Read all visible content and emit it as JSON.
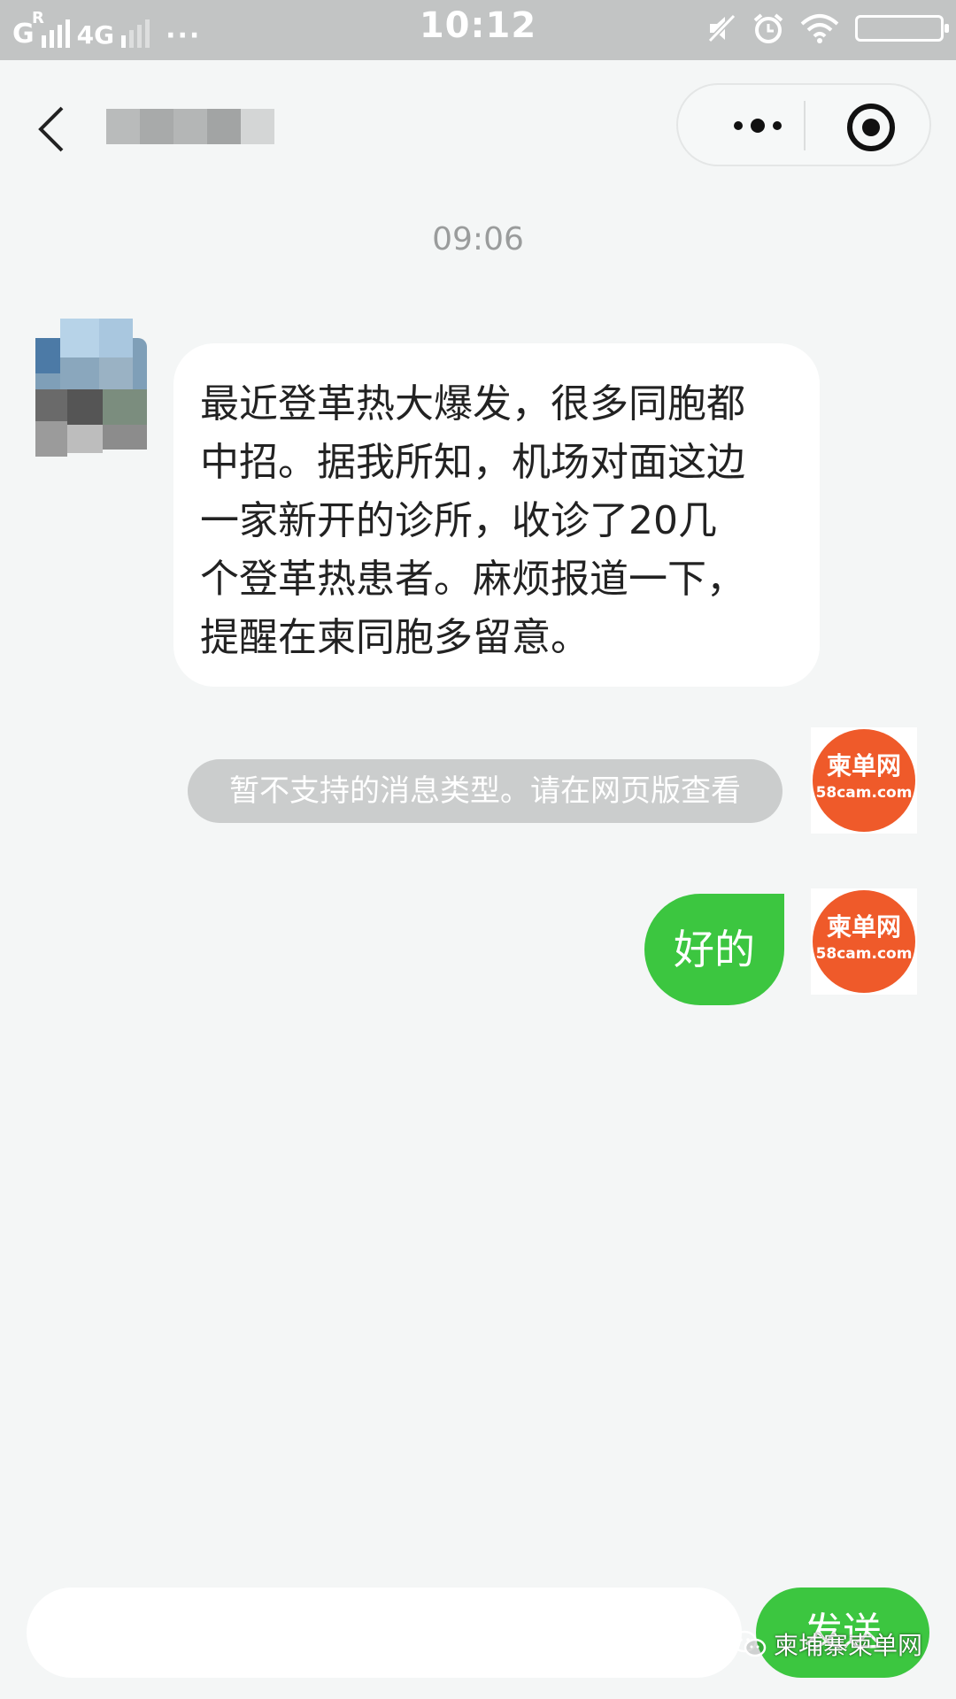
{
  "status_bar": {
    "network_primary": "G",
    "roaming": "R",
    "network_secondary": "4G",
    "more_dots": "···",
    "time": "10:12",
    "icons": [
      "signal-bars-icon",
      "mute-icon",
      "alarm-icon",
      "wifi-icon",
      "battery-icon"
    ]
  },
  "nav": {
    "back_icon": "chevron-left-icon",
    "title_blurred": true,
    "more_icon": "more-dots-icon",
    "close_icon": "target-circle-icon"
  },
  "chat": {
    "timestamp": "09:06",
    "incoming": {
      "lines": [
        "最近登革热大爆发，很多同胞都",
        "中招。据我所知，机场对面这边",
        "一家新开的诊所，收诊了20几",
        "个登革热患者。麻烦报道一下，",
        "提醒在柬同胞多留意。"
      ]
    },
    "system_notice": "暂不支持的消息类型。请在网页版查看",
    "outgoing": {
      "text": "好的"
    },
    "self_avatar": {
      "title": "柬单网",
      "domain": "58cam.com"
    }
  },
  "input_bar": {
    "value": "",
    "send_label": "发送"
  },
  "watermark": {
    "icon": "wechat-icon",
    "text": "柬埔寨柬单网"
  },
  "colors": {
    "status_bar_bg": "#c2c4c4",
    "page_bg": "#f4f6f6",
    "bubble_green": "#3cc640",
    "brand_orange": "#ef5a2a",
    "system_pill": "#cbcdcd"
  }
}
